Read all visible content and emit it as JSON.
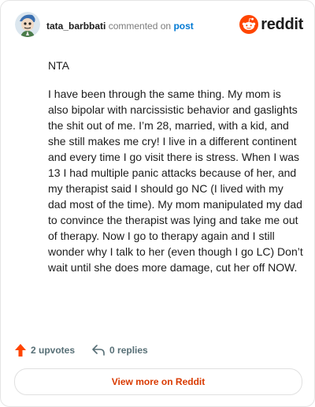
{
  "header": {
    "username": "tata_barbbati",
    "action_text": "commented on",
    "post_link": "post",
    "brand": "reddit"
  },
  "comment": {
    "paragraphs": [
      "NTA",
      "I have been through the same thing. My mom is also bipolar with narcissistic behavior and gaslights the shit out of me. I’m 28, married, with a kid, and she still makes me cry! I live in a different continent and every time I go visit there is stress. When I was 13 I had multiple panic attacks because of her, and my therapist said I should go NC (I lived with my dad most of the time). My mom manipulated my dad to convince the therapist was lying and take me out of therapy. Now I go to therapy again and I still wonder why I talk to her (even though I go LC) Don’t wait until she does more damage, cut her off NOW."
    ]
  },
  "actions": {
    "upvotes": "2 upvotes",
    "replies": "0 replies"
  },
  "footer": {
    "view_more": "View more on Reddit"
  },
  "colors": {
    "brand_orange": "#ff4500",
    "link_blue": "#0079d3",
    "view_more_text": "#d93a00"
  }
}
